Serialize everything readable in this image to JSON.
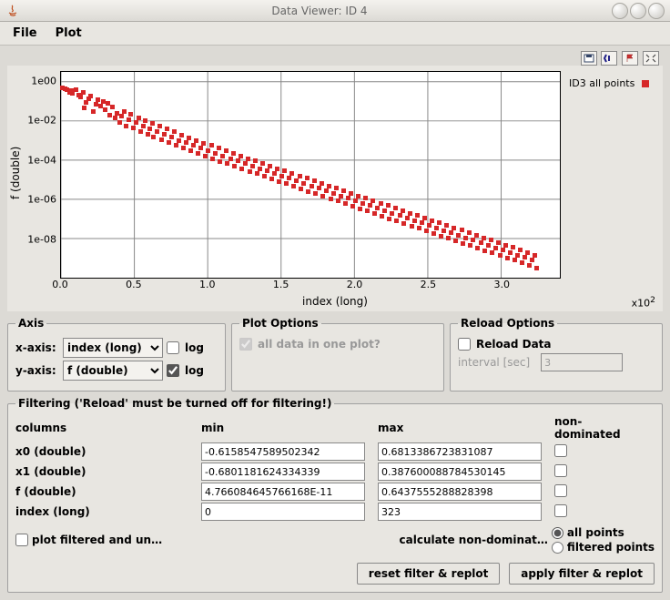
{
  "window": {
    "title": "Data Viewer: ID 4",
    "menu": {
      "file": "File",
      "plot": "Plot"
    }
  },
  "legend": {
    "label": "ID3 all points"
  },
  "axis_panel": {
    "title": "Axis",
    "x_label": "x-axis:",
    "y_label": "y-axis:",
    "x_value": "index (long)",
    "y_value": "f (double)",
    "log_label": "log",
    "x_log": false,
    "y_log": true
  },
  "plot_options": {
    "title": "Plot Options",
    "all_data_label": "all data in one plot?",
    "all_data_checked": true
  },
  "reload": {
    "title": "Reload Options",
    "reload_label": "Reload Data",
    "reload_checked": false,
    "interval_label": "interval [sec]",
    "interval_value": "3"
  },
  "filtering": {
    "title": "Filtering ('Reload' must be turned off for filtering!)",
    "columns_hdr": "columns",
    "min_hdr": "min",
    "max_hdr": "max",
    "nd_hdr": "non-dominated",
    "rows": [
      {
        "name": "x0 (double)",
        "min": "-0.6158547589502342",
        "max": "0.6813386723831087"
      },
      {
        "name": "x1 (double)",
        "min": "-0.6801181624334339",
        "max": "0.387600088784530145"
      },
      {
        "name": "f (double)",
        "min": "4.766084645766168E-11",
        "max": "0.6437555288828398"
      },
      {
        "name": "index (long)",
        "min": "0",
        "max": "323"
      }
    ],
    "plot_filtered_label": "plot filtered and un…",
    "calc_nd_label": "calculate non-dominat…",
    "radio_all": "all points",
    "radio_filtered": "filtered points",
    "reset_btn": "reset filter & replot",
    "apply_btn": "apply filter & replot"
  },
  "chart_data": {
    "type": "scatter",
    "title": "",
    "xlabel": "index (long)",
    "ylabel": "f (double)",
    "series_name": "ID3 all points",
    "x_range": [
      0,
      340
    ],
    "y_range_log10": [
      -10,
      0.5
    ],
    "y_scale": "log",
    "x_ticks": [
      0,
      50,
      100,
      150,
      200,
      250,
      300
    ],
    "x_tick_labels": [
      "0.0",
      "0.5",
      "1.0",
      "1.5",
      "2.0",
      "2.5",
      "3.0"
    ],
    "x_exp_label": "x10²",
    "y_ticks_log10": [
      0,
      -2,
      -4,
      -6,
      -8
    ],
    "y_tick_labels": [
      "1e00",
      "1e-02",
      "1e-04",
      "1e-06",
      "1e-08"
    ],
    "color": "#d62728",
    "points": [
      [
        1,
        0.5
      ],
      [
        3,
        0.46
      ],
      [
        4,
        0.4
      ],
      [
        6,
        0.3
      ],
      [
        7,
        0.36
      ],
      [
        8,
        0.25
      ],
      [
        10,
        0.42
      ],
      [
        12,
        0.22
      ],
      [
        13,
        0.18
      ],
      [
        15,
        0.28
      ],
      [
        16,
        0.05
      ],
      [
        17,
        0.09
      ],
      [
        19,
        0.14
      ],
      [
        20,
        0.2
      ],
      [
        22,
        0.03
      ],
      [
        24,
        0.07
      ],
      [
        25,
        0.13
      ],
      [
        27,
        0.06
      ],
      [
        29,
        0.1
      ],
      [
        30,
        0.04
      ],
      [
        32,
        0.085
      ],
      [
        33,
        0.02
      ],
      [
        35,
        0.055
      ],
      [
        37,
        0.015
      ],
      [
        38,
        0.026
      ],
      [
        40,
        0.009
      ],
      [
        41,
        0.018
      ],
      [
        43,
        0.032
      ],
      [
        44,
        0.006
      ],
      [
        46,
        0.012
      ],
      [
        47,
        0.022
      ],
      [
        49,
        0.0045
      ],
      [
        51,
        0.0085
      ],
      [
        53,
        0.015
      ],
      [
        54,
        0.003
      ],
      [
        56,
        0.006
      ],
      [
        57,
        0.011
      ],
      [
        59,
        0.0022
      ],
      [
        60,
        0.004
      ],
      [
        62,
        0.0075
      ],
      [
        63,
        0.0016
      ],
      [
        65,
        0.003
      ],
      [
        67,
        0.0055
      ],
      [
        68,
        0.0012
      ],
      [
        70,
        0.0022
      ],
      [
        72,
        0.004
      ],
      [
        73,
        0.00085
      ],
      [
        75,
        0.0016
      ],
      [
        77,
        0.003
      ],
      [
        78,
        0.0006
      ],
      [
        80,
        0.0011
      ],
      [
        82,
        0.0021
      ],
      [
        83,
        0.00045
      ],
      [
        85,
        0.00082
      ],
      [
        87,
        0.0015
      ],
      [
        88,
        0.00032
      ],
      [
        90,
        0.0006
      ],
      [
        92,
        0.0011
      ],
      [
        93,
        0.00024
      ],
      [
        95,
        0.00044
      ],
      [
        97,
        0.0008
      ],
      [
        98,
        0.00018
      ],
      [
        100,
        0.00033
      ],
      [
        102,
        0.0006
      ],
      [
        103,
        0.00013
      ],
      [
        105,
        0.00024
      ],
      [
        107,
        0.00044
      ],
      [
        108,
        9.5e-05
      ],
      [
        110,
        0.00018
      ],
      [
        112,
        0.00032
      ],
      [
        113,
        7.1e-05
      ],
      [
        115,
        0.00013
      ],
      [
        117,
        0.00024
      ],
      [
        118,
        5.3e-05
      ],
      [
        120,
        9.8e-05
      ],
      [
        122,
        0.00018
      ],
      [
        123,
        4e-05
      ],
      [
        125,
        7.3e-05
      ],
      [
        127,
        0.00013
      ],
      [
        128,
        3e-05
      ],
      [
        130,
        5.5e-05
      ],
      [
        132,
        9.8e-05
      ],
      [
        133,
        2.2e-05
      ],
      [
        135,
        4.1e-05
      ],
      [
        137,
        7.4e-05
      ],
      [
        138,
        1.7e-05
      ],
      [
        140,
        3.1e-05
      ],
      [
        142,
        5.5e-05
      ],
      [
        143,
        1.2e-05
      ],
      [
        145,
        2.3e-05
      ],
      [
        147,
        4.1e-05
      ],
      [
        148,
        9.3e-06
      ],
      [
        150,
        1.7e-05
      ],
      [
        152,
        3.1e-05
      ],
      [
        153,
        7e-06
      ],
      [
        155,
        1.3e-05
      ],
      [
        157,
        2.3e-05
      ],
      [
        158,
        5.2e-06
      ],
      [
        160,
        9.7e-06
      ],
      [
        162,
        1.7e-05
      ],
      [
        163,
        3.9e-06
      ],
      [
        165,
        7.2e-06
      ],
      [
        167,
        1.3e-05
      ],
      [
        168,
        2.9e-06
      ],
      [
        170,
        5.4e-06
      ],
      [
        172,
        9.8e-06
      ],
      [
        173,
        2.2e-06
      ],
      [
        175,
        4.1e-06
      ],
      [
        177,
        7.3e-06
      ],
      [
        178,
        1.7e-06
      ],
      [
        180,
        3e-06
      ],
      [
        182,
        5.5e-06
      ],
      [
        183,
        1.2e-06
      ],
      [
        185,
        2.3e-06
      ],
      [
        187,
        4.1e-06
      ],
      [
        188,
        9.3e-07
      ],
      [
        190,
        1.7e-06
      ],
      [
        192,
        3.1e-06
      ],
      [
        193,
        6.9e-07
      ],
      [
        195,
        1.3e-06
      ],
      [
        197,
        2.3e-06
      ],
      [
        198,
        5.2e-07
      ],
      [
        200,
        9.7e-07
      ],
      [
        202,
        1.7e-06
      ],
      [
        203,
        3.9e-07
      ],
      [
        205,
        7.2e-07
      ],
      [
        207,
        1.3e-06
      ],
      [
        208,
        2.9e-07
      ],
      [
        210,
        5.4e-07
      ],
      [
        212,
        9.8e-07
      ],
      [
        213,
        2.2e-07
      ],
      [
        215,
        4e-07
      ],
      [
        217,
        7.3e-07
      ],
      [
        218,
        1.6e-07
      ],
      [
        220,
        3e-07
      ],
      [
        222,
        5.5e-07
      ],
      [
        223,
        1.2e-07
      ],
      [
        225,
        2.3e-07
      ],
      [
        227,
        4.1e-07
      ],
      [
        228,
        9.3e-08
      ],
      [
        230,
        1.7e-07
      ],
      [
        232,
        3.1e-07
      ],
      [
        233,
        6.9e-08
      ],
      [
        235,
        1.3e-07
      ],
      [
        237,
        2.3e-07
      ],
      [
        238,
        5.2e-08
      ],
      [
        240,
        9.7e-08
      ],
      [
        242,
        1.7e-07
      ],
      [
        243,
        3.9e-08
      ],
      [
        245,
        7.2e-08
      ],
      [
        247,
        1.3e-07
      ],
      [
        248,
        2.9e-08
      ],
      [
        250,
        5.4e-08
      ],
      [
        252,
        9.8e-08
      ],
      [
        253,
        2.2e-08
      ],
      [
        255,
        4e-08
      ],
      [
        257,
        7.3e-08
      ],
      [
        258,
        1.6e-08
      ],
      [
        260,
        3e-08
      ],
      [
        262,
        5.5e-08
      ],
      [
        263,
        1.2e-08
      ],
      [
        265,
        2.3e-08
      ],
      [
        267,
        4.1e-08
      ],
      [
        268,
        9.3e-09
      ],
      [
        270,
        1.7e-08
      ],
      [
        272,
        3.1e-08
      ],
      [
        273,
        6.9e-09
      ],
      [
        275,
        1.3e-08
      ],
      [
        277,
        2.3e-08
      ],
      [
        278,
        5.2e-09
      ],
      [
        280,
        9.7e-09
      ],
      [
        282,
        1.7e-08
      ],
      [
        283,
        3.9e-09
      ],
      [
        285,
        7.2e-09
      ],
      [
        287,
        1.3e-08
      ],
      [
        288,
        2.9e-09
      ],
      [
        290,
        5.4e-09
      ],
      [
        292,
        9.8e-09
      ],
      [
        293,
        2.2e-09
      ],
      [
        295,
        4e-09
      ],
      [
        297,
        7.3e-09
      ],
      [
        298,
        1.6e-09
      ],
      [
        300,
        3e-09
      ],
      [
        302,
        5.5e-09
      ],
      [
        303,
        1.2e-09
      ],
      [
        305,
        2.3e-09
      ],
      [
        307,
        4.1e-09
      ],
      [
        308,
        9.3e-10
      ],
      [
        310,
        1.7e-09
      ],
      [
        312,
        3.1e-09
      ],
      [
        313,
        6.9e-10
      ],
      [
        315,
        1.3e-09
      ],
      [
        317,
        2.3e-09
      ],
      [
        318,
        5.2e-10
      ],
      [
        320,
        9.7e-10
      ],
      [
        322,
        1.7e-09
      ],
      [
        323,
        3.9e-10
      ]
    ]
  }
}
